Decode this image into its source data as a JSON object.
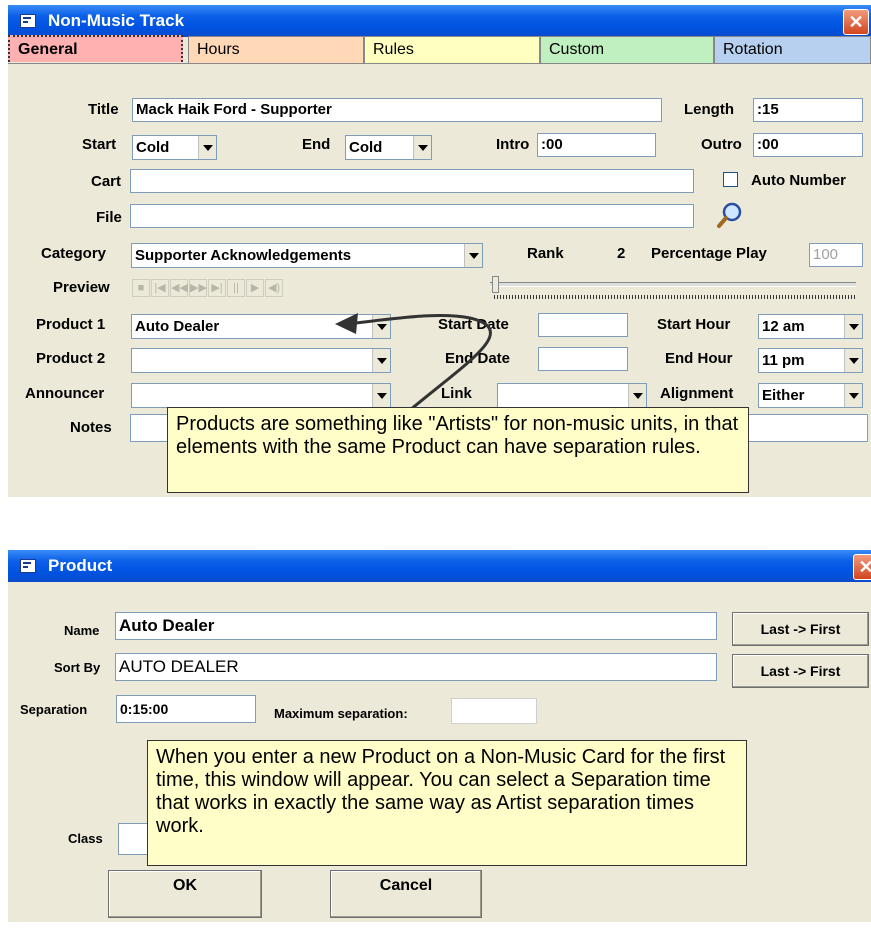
{
  "track_window": {
    "title": "Non-Music Track",
    "close_glyph": "✕",
    "tabs": [
      "General",
      "Hours",
      "Rules",
      "Custom",
      "Rotation"
    ],
    "tab_colors": [
      "#ffb0b0",
      "#ffd8b8",
      "#ffffc0",
      "#c0f0c0",
      "#b8d0f0"
    ],
    "fields": {
      "title_label": "Title",
      "title_value": "Mack Haik Ford - Supporter",
      "length_label": "Length",
      "length_value": ":15",
      "start_label": "Start",
      "start_value": "Cold",
      "end_label": "End",
      "end_value": "Cold",
      "intro_label": "Intro",
      "intro_value": ":00",
      "outro_label": "Outro",
      "outro_value": ":00",
      "cart_label": "Cart",
      "cart_value": "",
      "auto_number_label": "Auto Number",
      "file_label": "File",
      "file_value": "",
      "category_label": "Category",
      "category_value": "Supporter Acknowledgements",
      "rank_label": "Rank",
      "rank_value": "2",
      "percentage_play_label": "Percentage Play",
      "percentage_play_value": "100",
      "preview_label": "Preview",
      "product1_label": "Product 1",
      "product1_value": "Auto Dealer",
      "product2_label": "Product 2",
      "product2_value": "",
      "start_date_label": "Start Date",
      "end_date_label": "End Date",
      "start_hour_label": "Start Hour",
      "start_hour_value": "12 am",
      "end_hour_label": "End Hour",
      "end_hour_value": "11 pm",
      "announcer_label": "Announcer",
      "link_label": "Link",
      "alignment_label": "Alignment",
      "alignment_value": "Either",
      "notes_label": "Notes"
    },
    "preview_buttons": [
      "stop-icon",
      "first-icon",
      "rewind-icon",
      "fast-forward-icon",
      "last-icon",
      "pause-icon",
      "play-icon",
      "volume-icon"
    ],
    "callout": "Products are something like \"Artists\" for non-music units, in that elements with the same Product can have separation rules."
  },
  "product_window": {
    "title": "Product",
    "close_glyph": "✕",
    "name_label": "Name",
    "name_value": "Auto Dealer",
    "sort_by_label": "Sort By",
    "sort_by_value": "AUTO DEALER",
    "last_first_label": "Last -> First",
    "separation_label": "Separation",
    "separation_value": "0:15:00",
    "max_separation_label": "Maximum separation:",
    "max_separation_value": "",
    "class_label": "Class",
    "ok_label": "OK",
    "cancel_label": "Cancel",
    "callout": "When you enter a new Product on a Non-Music Card for the first time, this window will appear.  You can select a Separation time that works in exactly the same way as Artist separation times work."
  }
}
